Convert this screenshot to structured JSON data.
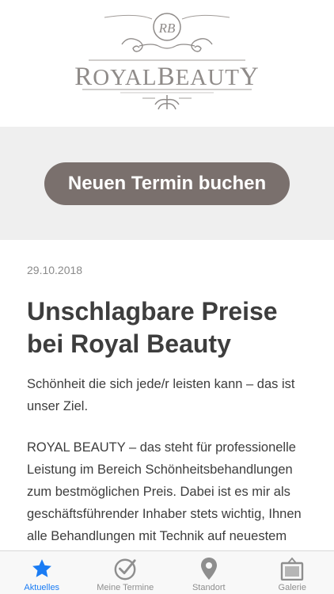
{
  "header": {
    "logo_monogram": "RB",
    "logo_wordmark": "RoyalBeauty"
  },
  "cta": {
    "label": "Neuen Termin buchen"
  },
  "article": {
    "date": "29.10.2018",
    "headline": "Unschlagbare Preise bei Royal Beauty",
    "paragraph1": "Schönheit die sich jede/r leisten kann – das ist unser Ziel.",
    "paragraph2": "ROYAL BEAUTY – das steht für professionelle Leistung im Bereich Schönheitsbehandlungen zum bestmöglichen Preis. Dabei ist es mir als geschäftsführender Inhaber stets wichtig, Ihnen alle Behandlungen mit Technik auf neuestem Stand anbieten zu können und"
  },
  "tabbar": {
    "active_color": "#1a7cf4",
    "inactive_color": "#8e8e8e",
    "tabs": [
      {
        "label": "Aktuelles",
        "icon": "star-icon",
        "active": true
      },
      {
        "label": "Meine Termine",
        "icon": "checkmark-circle-icon",
        "active": false
      },
      {
        "label": "Standort",
        "icon": "location-pin-icon",
        "active": false
      },
      {
        "label": "Galerie",
        "icon": "picture-frame-icon",
        "active": false
      }
    ]
  },
  "colors": {
    "button_bg": "#7a706d",
    "band_bg": "#efefef",
    "logo_gray": "#8f8b89"
  }
}
